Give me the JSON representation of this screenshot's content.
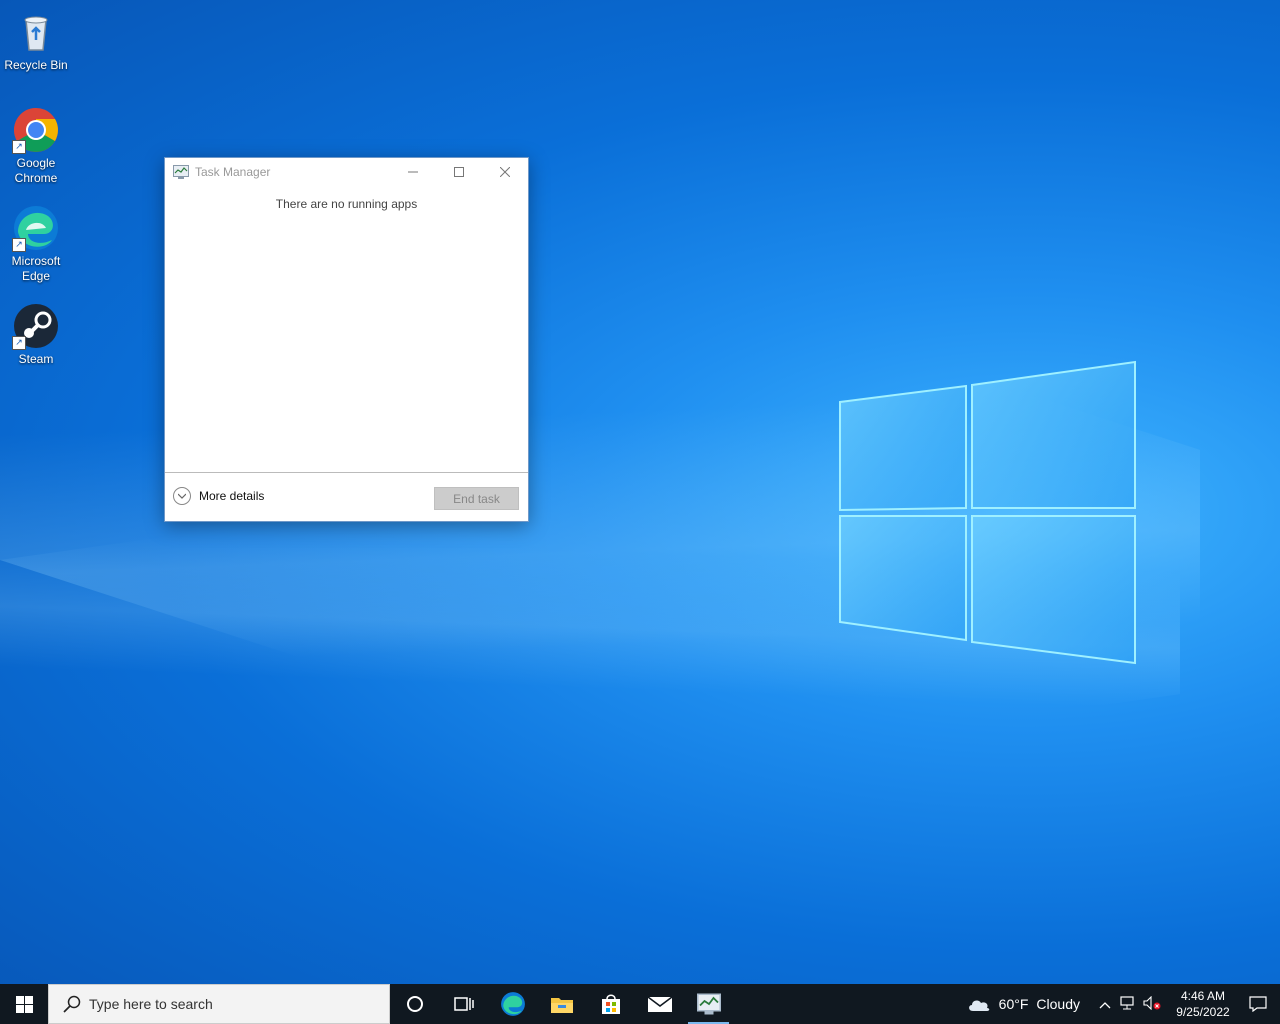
{
  "desktop": {
    "icons": [
      {
        "label": "Recycle Bin",
        "icon": "recycle-bin-icon"
      },
      {
        "label": "Google Chrome",
        "icon": "chrome-icon"
      },
      {
        "label": "Microsoft Edge",
        "icon": "edge-icon"
      },
      {
        "label": "Steam",
        "icon": "steam-icon"
      }
    ]
  },
  "task_manager": {
    "title": "Task Manager",
    "empty_message": "There are no running apps",
    "more_details_label": "More details",
    "end_task_label": "End task"
  },
  "taskbar": {
    "search_placeholder": "Type here to search",
    "pinned": [
      "cortana-icon",
      "task-view-icon",
      "edge-icon",
      "file-explorer-icon",
      "store-icon",
      "mail-icon",
      "task-manager-icon"
    ],
    "weather": {
      "temp": "60°F",
      "condition": "Cloudy"
    },
    "clock": {
      "time": "4:46 AM",
      "date": "9/25/2022"
    }
  },
  "colors": {
    "accent": "#0a6fd8",
    "taskbar": "#101820"
  }
}
